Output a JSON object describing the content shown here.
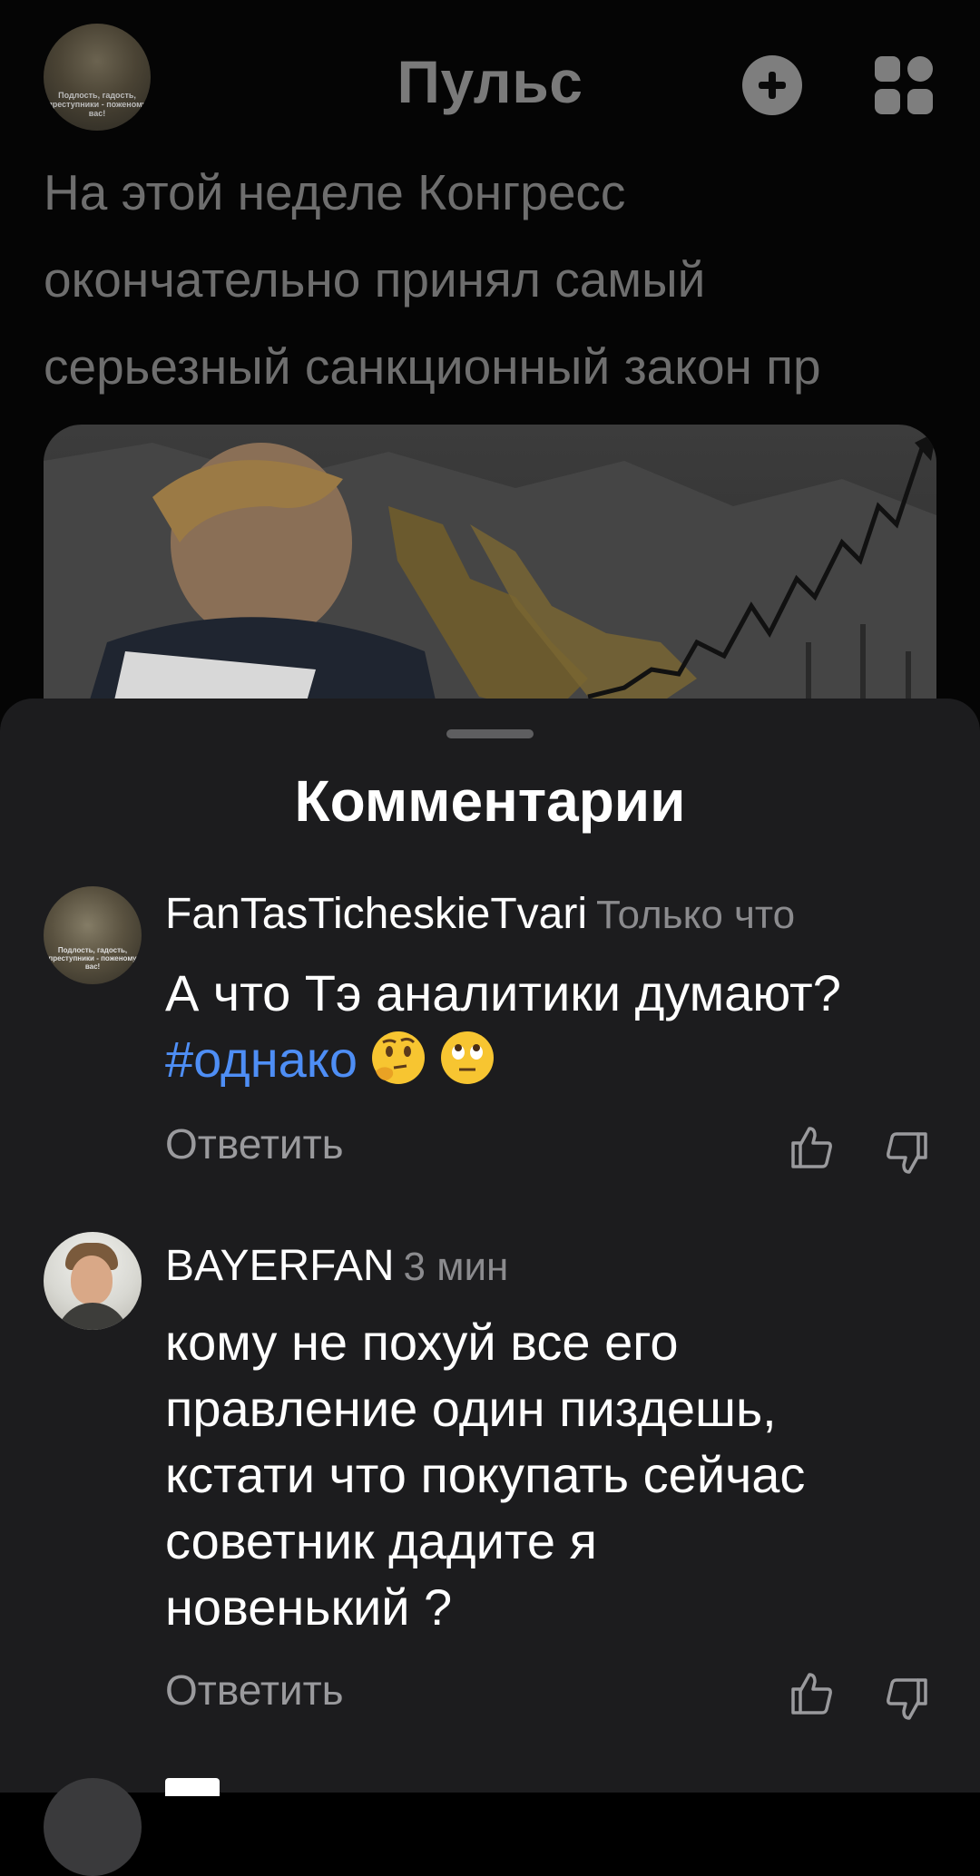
{
  "header": {
    "title": "Пульс",
    "avatar_caption": "Подлость, гадость, преступники - поженому вас!",
    "plus_icon": "plus-circle-icon",
    "menu_icon": "grid-menu-icon"
  },
  "post": {
    "lines": [
      "На этой неделе Конгресс",
      "окончательно принял самый",
      "серьезный санкционный закон пр"
    ]
  },
  "sheet": {
    "title": "Комментарии"
  },
  "comments": [
    {
      "author": "FanTasTicheskieTvari",
      "time": "Только что",
      "avatar_caption": "Подлость, гадость, преступники - поженому вас!",
      "text": "А что Тэ аналитики думают?",
      "hashtag": "#однако",
      "emojis": [
        "thinking-face",
        "face-with-rolling-eyes"
      ],
      "reply_label": "Ответить"
    },
    {
      "author": "BAYERFAN",
      "time": "3 мин",
      "text_lines": [
        "кому не похуй все его",
        "правление один пиздешь,",
        "кстати что покупать сейчас",
        "советник дадите я",
        "новенький ?"
      ],
      "reply_label": "Ответить"
    }
  ],
  "colors": {
    "sheet_bg": "#1c1c1e",
    "hashtag": "#4e8ef5",
    "muted": "#9a9a9d"
  }
}
